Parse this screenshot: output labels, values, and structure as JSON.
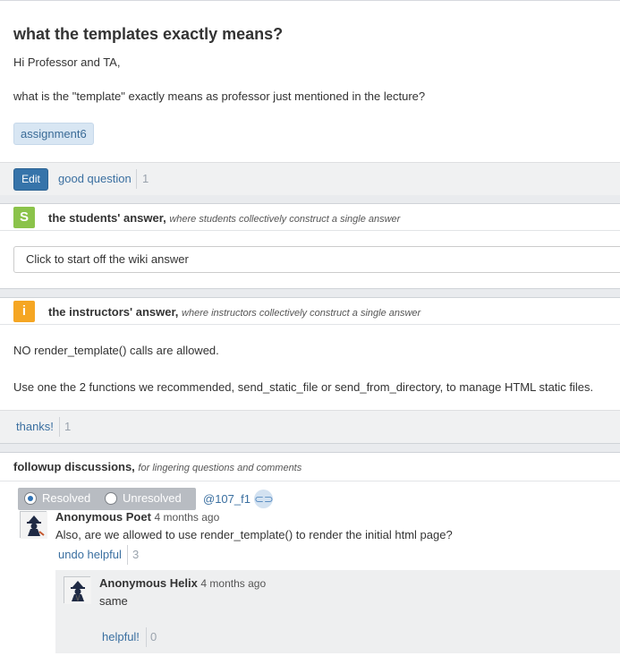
{
  "question": {
    "title": "what the templates exactly means?",
    "line1": "Hi Professor and TA,",
    "line2": "what is the \"template\" exactly means as professor just mentioned in the lecture?",
    "tag": "assignment6",
    "edit_label": "Edit",
    "good_question_label": "good question",
    "good_question_count": "1"
  },
  "students_answer": {
    "badge": "S",
    "title": "the students' answer,",
    "subtitle": "where students collectively construct a single answer",
    "placeholder": "Click to start off the wiki answer"
  },
  "instructors_answer": {
    "badge": "i",
    "title": "the instructors' answer,",
    "subtitle": "where instructors collectively construct a single answer",
    "line1": "NO render_template() calls are allowed.",
    "line2": "Use one the 2 functions we recommended, send_static_file or send_from_directory, to manage HTML static files.",
    "thanks_label": "thanks!",
    "thanks_count": "1"
  },
  "followup": {
    "title": "followup discussions,",
    "subtitle": "for lingering questions and comments",
    "resolved_label": "Resolved",
    "unresolved_label": "Unresolved",
    "thread_id": "@107_f1",
    "post": {
      "author": "Anonymous Poet",
      "time": "4 months ago",
      "text": "Also, are we allowed to use render_template() to render the initial html page?",
      "helpful_label": "undo helpful",
      "helpful_count": "3"
    },
    "reply": {
      "author": "Anonymous Helix",
      "time": "4 months ago",
      "text": "same",
      "helpful_label": "helpful!",
      "helpful_count": "0"
    }
  },
  "icons": [
    "students-badge-icon",
    "instructors-badge-icon",
    "link-icon",
    "anonymous-avatar-icon"
  ],
  "colors": {
    "accent": "#3674aa",
    "students": "#8bc34a",
    "instructors": "#f5a623",
    "link": "#3a6fa0"
  }
}
